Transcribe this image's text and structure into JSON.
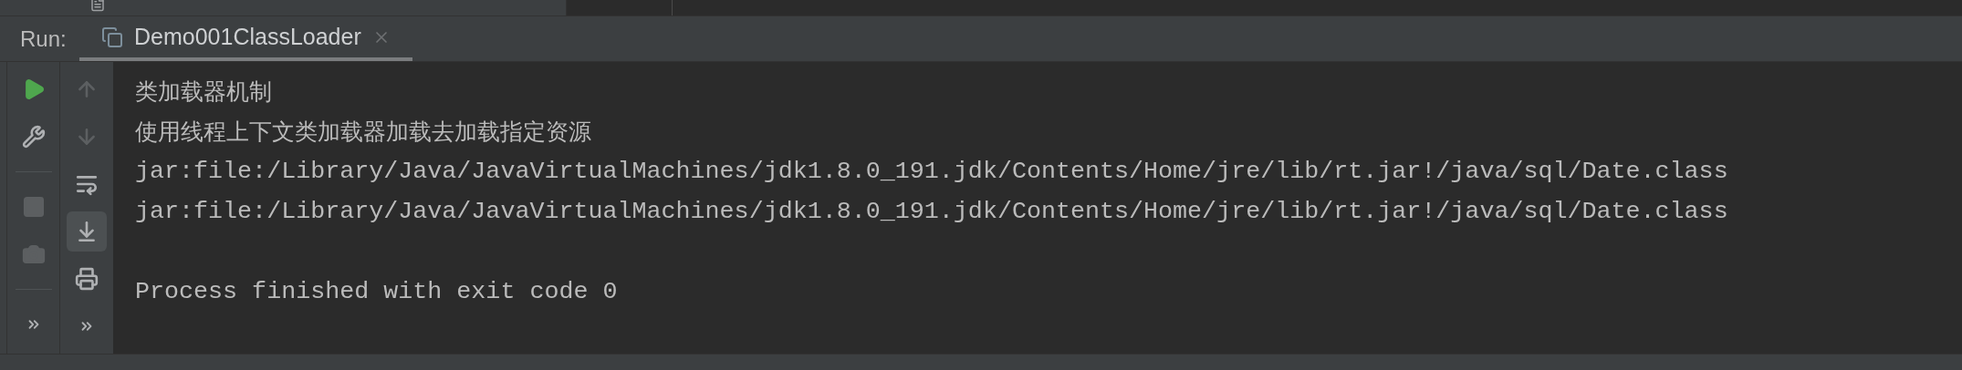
{
  "run_label": "Run:",
  "tabs": [
    {
      "title": "Demo001ClassLoader",
      "selected": true
    }
  ],
  "run_toolbar": [
    {
      "kind": "rerun",
      "disabled": false
    },
    {
      "kind": "settings",
      "disabled": false
    },
    {
      "kind": "separator"
    },
    {
      "kind": "stop",
      "disabled": true
    },
    {
      "kind": "snapshot",
      "disabled": true
    },
    {
      "kind": "separator"
    },
    {
      "kind": "more",
      "disabled": false
    }
  ],
  "console_toolbar": [
    {
      "kind": "up",
      "disabled": true,
      "on": false
    },
    {
      "kind": "down",
      "disabled": true,
      "on": false
    },
    {
      "kind": "wrap",
      "disabled": false,
      "on": false
    },
    {
      "kind": "scroll_to_end",
      "disabled": false,
      "on": true
    },
    {
      "kind": "print",
      "disabled": false,
      "on": false
    },
    {
      "kind": "more",
      "disabled": false,
      "on": false
    }
  ],
  "console": [
    {
      "kind": "text",
      "text": "类加载器机制"
    },
    {
      "kind": "text",
      "text": "使用线程上下文类加载器加载去加载指定资源"
    },
    {
      "kind": "code",
      "text": "jar:file:/Library/Java/JavaVirtualMachines/jdk1.8.0_191.jdk/Contents/Home/jre/lib/rt.jar!/java/sql/Date.class"
    },
    {
      "kind": "code",
      "text": "jar:file:/Library/Java/JavaVirtualMachines/jdk1.8.0_191.jdk/Contents/Home/jre/lib/rt.jar!/java/sql/Date.class"
    },
    {
      "kind": "blank"
    },
    {
      "kind": "code",
      "text": "Process finished with exit code 0"
    }
  ]
}
